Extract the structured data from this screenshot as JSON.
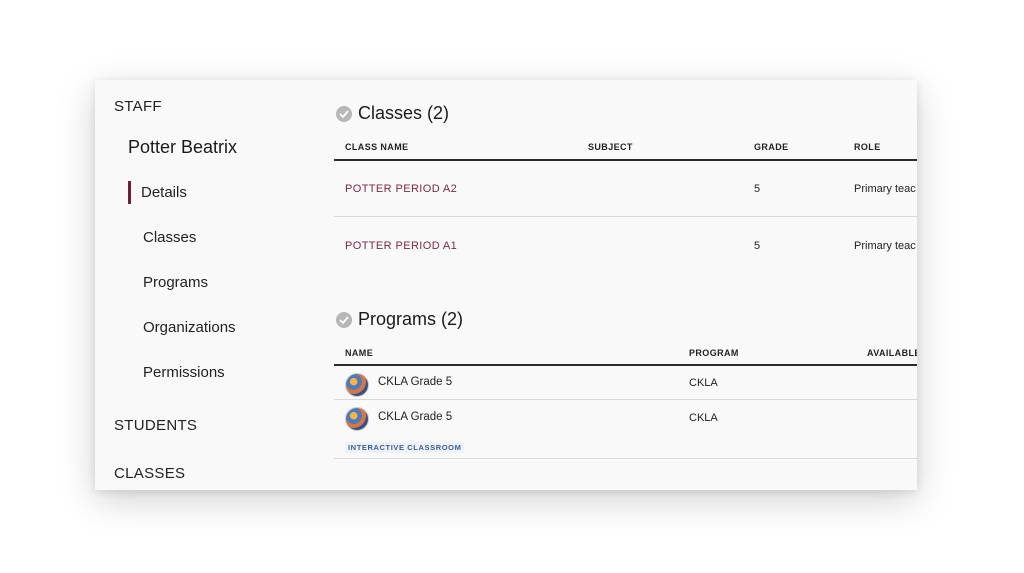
{
  "sidebar": {
    "sections": {
      "staff": "STAFF",
      "students": "STUDENTS",
      "classes": "CLASSES"
    },
    "person_name": "Potter Beatrix",
    "items": [
      {
        "label": "Details",
        "active": true
      },
      {
        "label": "Classes",
        "active": false
      },
      {
        "label": "Programs",
        "active": false
      },
      {
        "label": "Organizations",
        "active": false
      },
      {
        "label": "Permissions",
        "active": false
      }
    ]
  },
  "classes_section": {
    "title": "Classes (2)",
    "icon": "check-circle-icon",
    "columns": [
      "CLASS NAME",
      "SUBJECT",
      "GRADE",
      "ROLE"
    ],
    "rows": [
      {
        "class_name": "POTTER PERIOD A2",
        "subject": "",
        "grade": "5",
        "role": "Primary teac"
      },
      {
        "class_name": "POTTER PERIOD A1",
        "subject": "",
        "grade": "5",
        "role": "Primary teac"
      }
    ]
  },
  "programs_section": {
    "title": "Programs (2)",
    "icon": "check-circle-icon",
    "columns": [
      "NAME",
      "PROGRAM",
      "AVAILABLE"
    ],
    "rows": [
      {
        "name": "CKLA Grade 5",
        "program": "CKLA",
        "tag": ""
      },
      {
        "name": "CKLA Grade 5",
        "program": "CKLA",
        "tag": "INTERACTIVE CLASSROOM"
      }
    ]
  },
  "colors": {
    "accent": "#6e1f34",
    "link": "#7a2a40",
    "tag_text": "#3b5f92"
  }
}
